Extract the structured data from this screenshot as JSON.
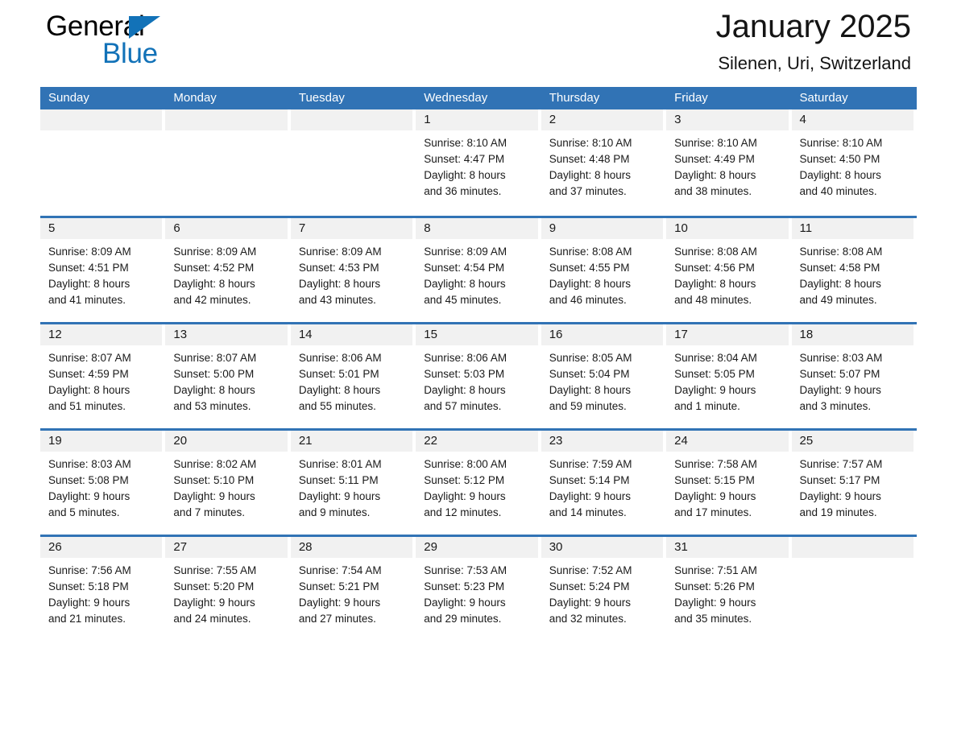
{
  "brand": {
    "name_part1": "General",
    "name_part2": "Blue",
    "flag_icon": "triangle-flag-icon",
    "accent_color": "#1272b8"
  },
  "header": {
    "title": "January 2025",
    "subtitle": "Silenen, Uri, Switzerland"
  },
  "colors": {
    "header_blue": "#3173b5",
    "daynum_gray": "#f1f1f1",
    "text": "#1a1a1a"
  },
  "weekday_headers": [
    "Sunday",
    "Monday",
    "Tuesday",
    "Wednesday",
    "Thursday",
    "Friday",
    "Saturday"
  ],
  "weeks": [
    [
      {
        "day": "",
        "sunrise": "",
        "sunset": "",
        "daylight_line1": "",
        "daylight_line2": ""
      },
      {
        "day": "",
        "sunrise": "",
        "sunset": "",
        "daylight_line1": "",
        "daylight_line2": ""
      },
      {
        "day": "",
        "sunrise": "",
        "sunset": "",
        "daylight_line1": "",
        "daylight_line2": ""
      },
      {
        "day": "1",
        "sunrise": "Sunrise: 8:10 AM",
        "sunset": "Sunset: 4:47 PM",
        "daylight_line1": "Daylight: 8 hours",
        "daylight_line2": "and 36 minutes."
      },
      {
        "day": "2",
        "sunrise": "Sunrise: 8:10 AM",
        "sunset": "Sunset: 4:48 PM",
        "daylight_line1": "Daylight: 8 hours",
        "daylight_line2": "and 37 minutes."
      },
      {
        "day": "3",
        "sunrise": "Sunrise: 8:10 AM",
        "sunset": "Sunset: 4:49 PM",
        "daylight_line1": "Daylight: 8 hours",
        "daylight_line2": "and 38 minutes."
      },
      {
        "day": "4",
        "sunrise": "Sunrise: 8:10 AM",
        "sunset": "Sunset: 4:50 PM",
        "daylight_line1": "Daylight: 8 hours",
        "daylight_line2": "and 40 minutes."
      }
    ],
    [
      {
        "day": "5",
        "sunrise": "Sunrise: 8:09 AM",
        "sunset": "Sunset: 4:51 PM",
        "daylight_line1": "Daylight: 8 hours",
        "daylight_line2": "and 41 minutes."
      },
      {
        "day": "6",
        "sunrise": "Sunrise: 8:09 AM",
        "sunset": "Sunset: 4:52 PM",
        "daylight_line1": "Daylight: 8 hours",
        "daylight_line2": "and 42 minutes."
      },
      {
        "day": "7",
        "sunrise": "Sunrise: 8:09 AM",
        "sunset": "Sunset: 4:53 PM",
        "daylight_line1": "Daylight: 8 hours",
        "daylight_line2": "and 43 minutes."
      },
      {
        "day": "8",
        "sunrise": "Sunrise: 8:09 AM",
        "sunset": "Sunset: 4:54 PM",
        "daylight_line1": "Daylight: 8 hours",
        "daylight_line2": "and 45 minutes."
      },
      {
        "day": "9",
        "sunrise": "Sunrise: 8:08 AM",
        "sunset": "Sunset: 4:55 PM",
        "daylight_line1": "Daylight: 8 hours",
        "daylight_line2": "and 46 minutes."
      },
      {
        "day": "10",
        "sunrise": "Sunrise: 8:08 AM",
        "sunset": "Sunset: 4:56 PM",
        "daylight_line1": "Daylight: 8 hours",
        "daylight_line2": "and 48 minutes."
      },
      {
        "day": "11",
        "sunrise": "Sunrise: 8:08 AM",
        "sunset": "Sunset: 4:58 PM",
        "daylight_line1": "Daylight: 8 hours",
        "daylight_line2": "and 49 minutes."
      }
    ],
    [
      {
        "day": "12",
        "sunrise": "Sunrise: 8:07 AM",
        "sunset": "Sunset: 4:59 PM",
        "daylight_line1": "Daylight: 8 hours",
        "daylight_line2": "and 51 minutes."
      },
      {
        "day": "13",
        "sunrise": "Sunrise: 8:07 AM",
        "sunset": "Sunset: 5:00 PM",
        "daylight_line1": "Daylight: 8 hours",
        "daylight_line2": "and 53 minutes."
      },
      {
        "day": "14",
        "sunrise": "Sunrise: 8:06 AM",
        "sunset": "Sunset: 5:01 PM",
        "daylight_line1": "Daylight: 8 hours",
        "daylight_line2": "and 55 minutes."
      },
      {
        "day": "15",
        "sunrise": "Sunrise: 8:06 AM",
        "sunset": "Sunset: 5:03 PM",
        "daylight_line1": "Daylight: 8 hours",
        "daylight_line2": "and 57 minutes."
      },
      {
        "day": "16",
        "sunrise": "Sunrise: 8:05 AM",
        "sunset": "Sunset: 5:04 PM",
        "daylight_line1": "Daylight: 8 hours",
        "daylight_line2": "and 59 minutes."
      },
      {
        "day": "17",
        "sunrise": "Sunrise: 8:04 AM",
        "sunset": "Sunset: 5:05 PM",
        "daylight_line1": "Daylight: 9 hours",
        "daylight_line2": "and 1 minute."
      },
      {
        "day": "18",
        "sunrise": "Sunrise: 8:03 AM",
        "sunset": "Sunset: 5:07 PM",
        "daylight_line1": "Daylight: 9 hours",
        "daylight_line2": "and 3 minutes."
      }
    ],
    [
      {
        "day": "19",
        "sunrise": "Sunrise: 8:03 AM",
        "sunset": "Sunset: 5:08 PM",
        "daylight_line1": "Daylight: 9 hours",
        "daylight_line2": "and 5 minutes."
      },
      {
        "day": "20",
        "sunrise": "Sunrise: 8:02 AM",
        "sunset": "Sunset: 5:10 PM",
        "daylight_line1": "Daylight: 9 hours",
        "daylight_line2": "and 7 minutes."
      },
      {
        "day": "21",
        "sunrise": "Sunrise: 8:01 AM",
        "sunset": "Sunset: 5:11 PM",
        "daylight_line1": "Daylight: 9 hours",
        "daylight_line2": "and 9 minutes."
      },
      {
        "day": "22",
        "sunrise": "Sunrise: 8:00 AM",
        "sunset": "Sunset: 5:12 PM",
        "daylight_line1": "Daylight: 9 hours",
        "daylight_line2": "and 12 minutes."
      },
      {
        "day": "23",
        "sunrise": "Sunrise: 7:59 AM",
        "sunset": "Sunset: 5:14 PM",
        "daylight_line1": "Daylight: 9 hours",
        "daylight_line2": "and 14 minutes."
      },
      {
        "day": "24",
        "sunrise": "Sunrise: 7:58 AM",
        "sunset": "Sunset: 5:15 PM",
        "daylight_line1": "Daylight: 9 hours",
        "daylight_line2": "and 17 minutes."
      },
      {
        "day": "25",
        "sunrise": "Sunrise: 7:57 AM",
        "sunset": "Sunset: 5:17 PM",
        "daylight_line1": "Daylight: 9 hours",
        "daylight_line2": "and 19 minutes."
      }
    ],
    [
      {
        "day": "26",
        "sunrise": "Sunrise: 7:56 AM",
        "sunset": "Sunset: 5:18 PM",
        "daylight_line1": "Daylight: 9 hours",
        "daylight_line2": "and 21 minutes."
      },
      {
        "day": "27",
        "sunrise": "Sunrise: 7:55 AM",
        "sunset": "Sunset: 5:20 PM",
        "daylight_line1": "Daylight: 9 hours",
        "daylight_line2": "and 24 minutes."
      },
      {
        "day": "28",
        "sunrise": "Sunrise: 7:54 AM",
        "sunset": "Sunset: 5:21 PM",
        "daylight_line1": "Daylight: 9 hours",
        "daylight_line2": "and 27 minutes."
      },
      {
        "day": "29",
        "sunrise": "Sunrise: 7:53 AM",
        "sunset": "Sunset: 5:23 PM",
        "daylight_line1": "Daylight: 9 hours",
        "daylight_line2": "and 29 minutes."
      },
      {
        "day": "30",
        "sunrise": "Sunrise: 7:52 AM",
        "sunset": "Sunset: 5:24 PM",
        "daylight_line1": "Daylight: 9 hours",
        "daylight_line2": "and 32 minutes."
      },
      {
        "day": "31",
        "sunrise": "Sunrise: 7:51 AM",
        "sunset": "Sunset: 5:26 PM",
        "daylight_line1": "Daylight: 9 hours",
        "daylight_line2": "and 35 minutes."
      },
      {
        "day": "",
        "sunrise": "",
        "sunset": "",
        "daylight_line1": "",
        "daylight_line2": ""
      }
    ]
  ]
}
